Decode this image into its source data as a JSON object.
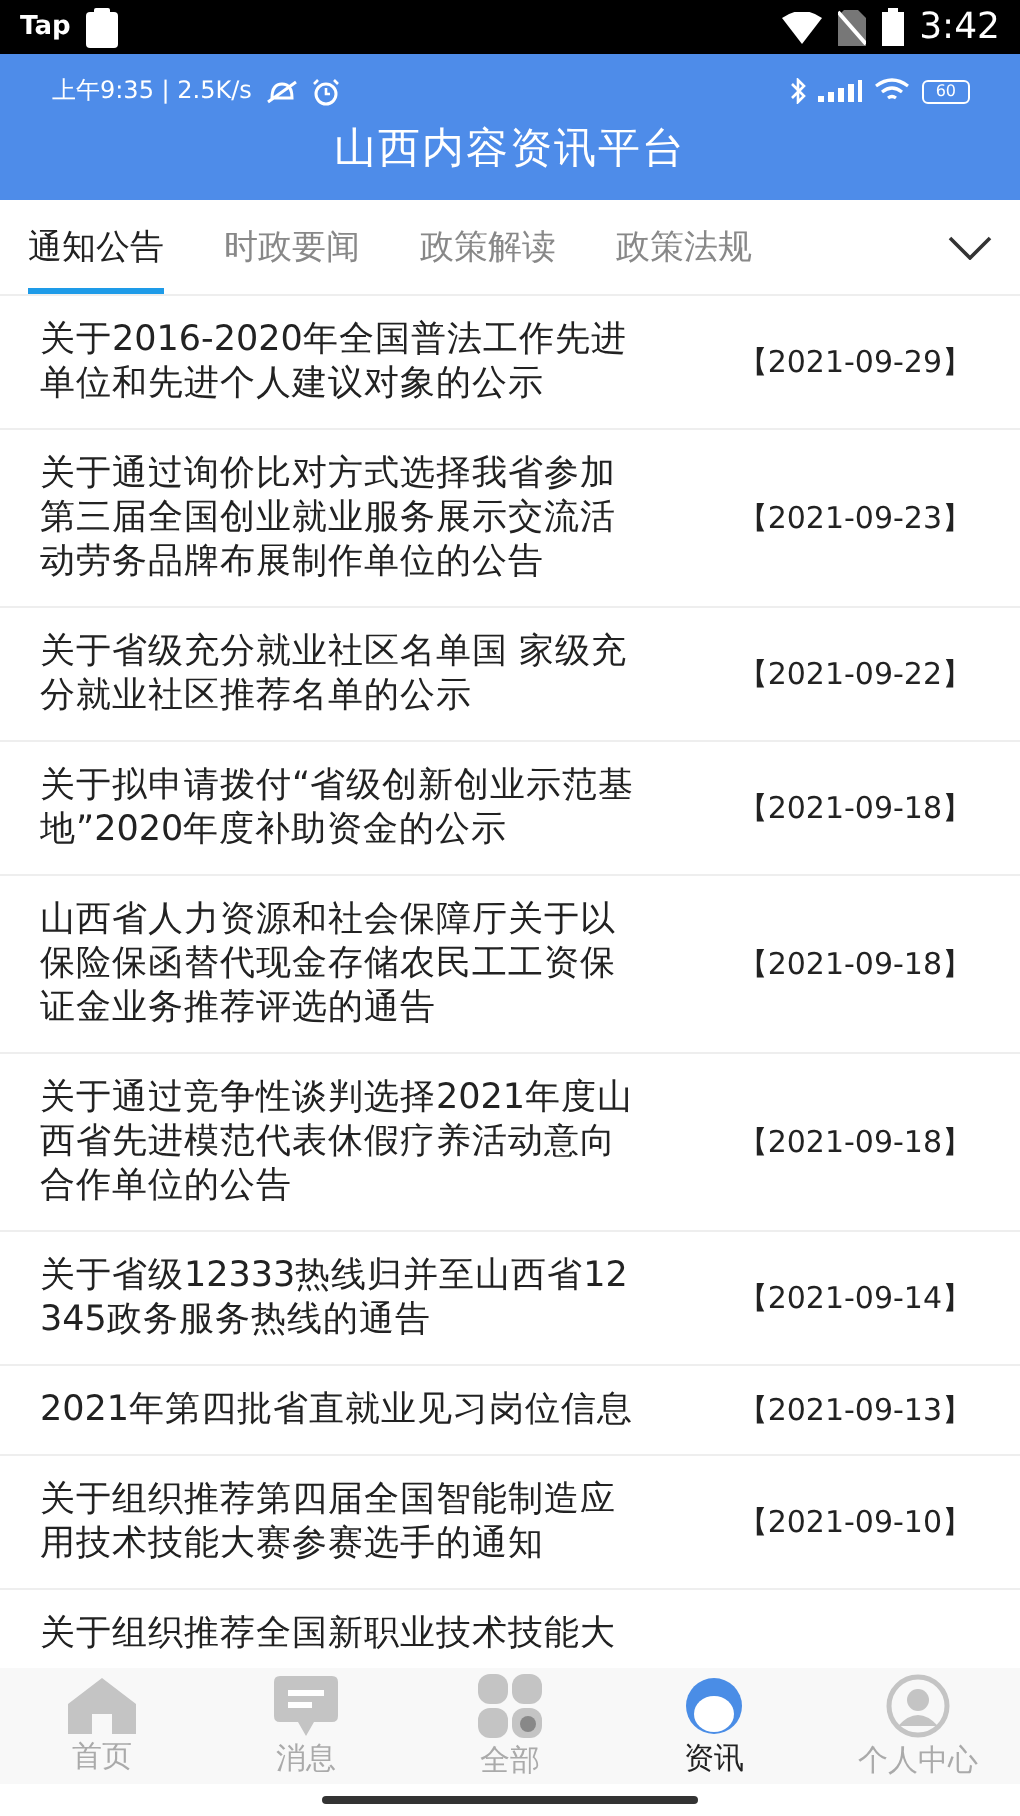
{
  "system_status": {
    "app_label": "Tap",
    "time": "3:42"
  },
  "inner_status": {
    "time_speed": "上午9:35 | 2.5K/s",
    "battery": "60"
  },
  "header": {
    "title": "山西内容资讯平台"
  },
  "tabs": [
    {
      "label": "通知公告",
      "selected": true
    },
    {
      "label": "时政要闻",
      "selected": false
    },
    {
      "label": "政策解读",
      "selected": false
    },
    {
      "label": "政策法规",
      "selected": false
    }
  ],
  "articles": [
    {
      "title": "关于2016-2020年全国普法工作先进单位和先进个人建议对象的公示",
      "date": "【2021-09-29】"
    },
    {
      "title": "关于通过询价比对方式选择我省参加第三届全国创业就业服务展示交流活动劳务品牌布展制作单位的公告",
      "date": "【2021-09-23】"
    },
    {
      "title": "关于省级充分就业社区名单国 家级充分就业社区推荐名单的公示",
      "date": "【2021-09-22】"
    },
    {
      "title": "关于拟申请拨付“省级创新创业示范基地”2020年度补助资金的公示",
      "date": "【2021-09-18】"
    },
    {
      "title": "山西省人力资源和社会保障厅关于以保险保函替代现金存储农民工工资保证金业务推荐评选的通告",
      "date": "【2021-09-18】"
    },
    {
      "title": "关于通过竞争性谈判选择2021年度山西省先进模范代表休假疗养活动意向合作单位的公告",
      "date": "【2021-09-18】"
    },
    {
      "title": "关于省级12333热线归并至山西省12345政务服务热线的通告",
      "date": "【2021-09-14】"
    },
    {
      "title": "2021年第四批省直就业见习岗位信息",
      "date": "【2021-09-13】"
    },
    {
      "title": "关于组织推荐第四届全国智能制造应用技术技能大赛参赛选手的通知",
      "date": "【2021-09-10】"
    },
    {
      "title": "关于组织推荐全国新职业技术技能大"
    }
  ],
  "bottom_nav": [
    {
      "label": "首页",
      "kind": "home",
      "selected": false
    },
    {
      "label": "消息",
      "kind": "message",
      "selected": false
    },
    {
      "label": "全部",
      "kind": "grid",
      "selected": false
    },
    {
      "label": "资讯",
      "kind": "avatar",
      "selected": true
    },
    {
      "label": "个人中心",
      "kind": "person",
      "selected": false
    }
  ]
}
